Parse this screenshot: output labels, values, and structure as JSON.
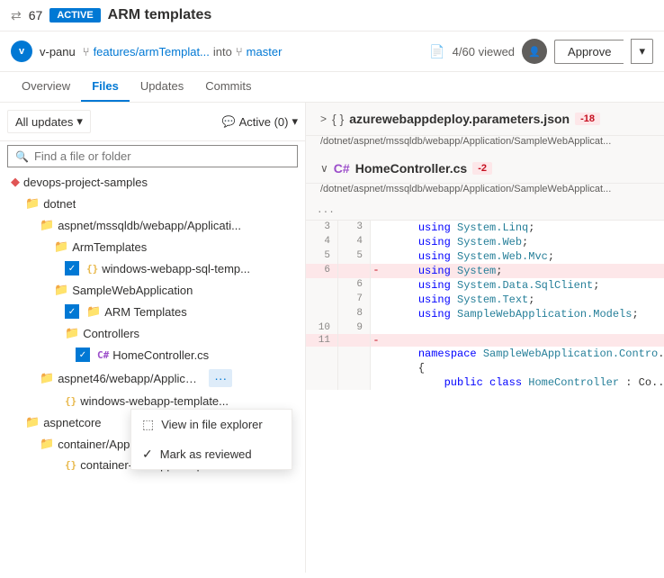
{
  "header": {
    "pr_icon": "⇄",
    "pr_count": "67",
    "status": "ACTIVE",
    "title": "ARM templates",
    "user": "v-panu",
    "branch_from": "features/armTemplat...",
    "branch_into": "into",
    "branch_to": "master",
    "viewed": "4/60 viewed",
    "approve_label": "Approve",
    "dropdown_label": "▾"
  },
  "tabs": [
    {
      "label": "Overview",
      "active": false
    },
    {
      "label": "Files",
      "active": true
    },
    {
      "label": "Updates",
      "active": false
    },
    {
      "label": "Commits",
      "active": false
    }
  ],
  "filter": {
    "all_updates": "All updates",
    "active_label": "Active (0)"
  },
  "search": {
    "placeholder": "Find a file or folder"
  },
  "file_tree": [
    {
      "indent": 0,
      "type": "repo",
      "label": "devops-project-samples",
      "icon": "◆"
    },
    {
      "indent": 1,
      "type": "folder",
      "label": "dotnet"
    },
    {
      "indent": 2,
      "type": "folder",
      "label": "aspnet/mssqldb/webapp/Applicati..."
    },
    {
      "indent": 3,
      "type": "folder",
      "label": "ArmTemplates",
      "checked": true
    },
    {
      "indent": 4,
      "type": "file-js",
      "label": "windows-webapp-sql-temp...",
      "checked": true
    },
    {
      "indent": 3,
      "type": "folder",
      "label": "SampleWebApplication"
    },
    {
      "indent": 4,
      "type": "folder",
      "label": "ARM Templates",
      "checked": true
    },
    {
      "indent": 4,
      "type": "folder",
      "label": "Controllers"
    },
    {
      "indent": 5,
      "type": "file-cs",
      "label": "HomeController.cs"
    },
    {
      "indent": 2,
      "type": "folder",
      "label": "aspnet46/webapp/Applicatio...",
      "has_menu": true
    },
    {
      "indent": 3,
      "type": "file-js",
      "label": "windows-webapp-template..."
    },
    {
      "indent": 1,
      "type": "folder",
      "label": "aspnetcore"
    },
    {
      "indent": 2,
      "type": "folder",
      "label": "container/Application/ArmTe..."
    },
    {
      "indent": 3,
      "type": "file-js",
      "label": "container-webapp-templat..."
    }
  ],
  "context_menu": {
    "items": [
      {
        "label": "View in file explorer",
        "icon": "⬚",
        "checked": false
      },
      {
        "label": "Mark as reviewed",
        "icon": "✓",
        "checked": true
      }
    ]
  },
  "right_panel": {
    "collapsed_file": {
      "expand_icon": ">",
      "brackets": "{ }",
      "name": "azurewebappdeploy.parameters.json",
      "diff": "-18",
      "path": "/dotnet/aspnet/mssqldb/webapp/Application/SampleWebApplicat..."
    },
    "code_file": {
      "expand_icon": "∨",
      "lang": "C#",
      "name": "HomeController.cs",
      "diff": "-2",
      "path": "/dotnet/aspnet/mssqldb/webapp/Application/SampleWebApplicat...",
      "ellipsis": "...",
      "lines": [
        {
          "old": "3",
          "new": "3",
          "indicator": "",
          "code": "    using System.Linq;",
          "type": "normal"
        },
        {
          "old": "4",
          "new": "4",
          "indicator": "",
          "code": "    using System.Web;",
          "type": "normal"
        },
        {
          "old": "5",
          "new": "5",
          "indicator": "",
          "code": "    using System.Web.Mvc;",
          "type": "normal"
        },
        {
          "old": "6",
          "new": "",
          "indicator": "-",
          "code": "    using System;",
          "type": "removed"
        },
        {
          "old": "",
          "new": "6",
          "indicator": "",
          "code": "    using System.Data.SqlClient;",
          "type": "normal"
        },
        {
          "old": "",
          "new": "7",
          "indicator": "",
          "code": "    using System.Text;",
          "type": "normal"
        },
        {
          "old": "",
          "new": "8",
          "indicator": "",
          "code": "    using SampleWebApplication.Models;",
          "type": "normal"
        },
        {
          "old": "10",
          "new": "9",
          "indicator": "",
          "code": "",
          "type": "normal"
        },
        {
          "old": "11",
          "new": "",
          "indicator": "-",
          "code": "",
          "type": "removed"
        },
        {
          "old": "",
          "new": "",
          "indicator": "",
          "code": "    namespace SampleWebApplication.Contro...",
          "type": "normal"
        },
        {
          "old": "",
          "new": "",
          "indicator": "",
          "code": "    {",
          "type": "normal"
        },
        {
          "old": "",
          "new": "",
          "indicator": "",
          "code": "        public class HomeController : Co...",
          "type": "normal"
        }
      ]
    }
  }
}
